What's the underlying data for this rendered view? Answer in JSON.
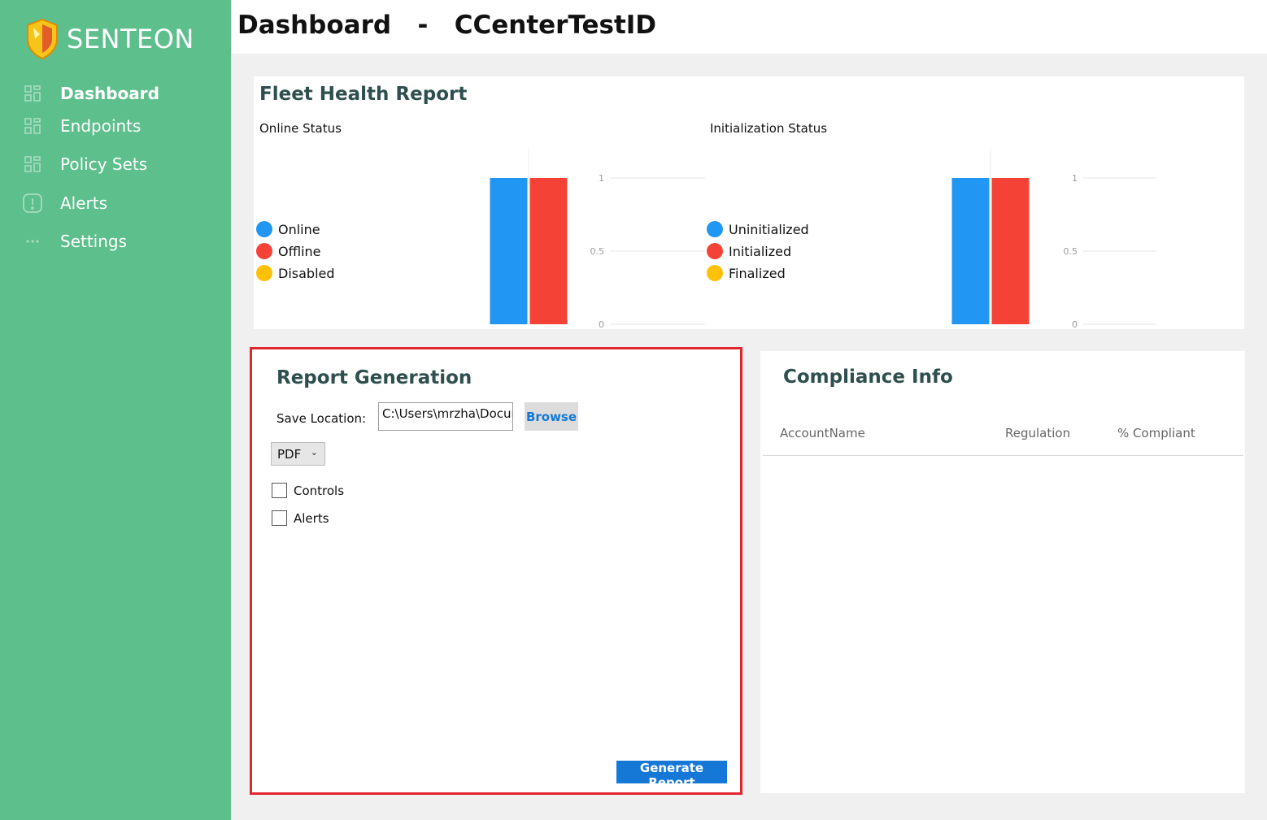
{
  "app": {
    "brand": "SENTEON",
    "header_page": "Dashboard",
    "header_separator": "-",
    "header_context": "CCenterTestID"
  },
  "sidebar": {
    "items": [
      {
        "label": "Dashboard",
        "icon": "grid-icon",
        "active": true
      },
      {
        "label": "Endpoints",
        "icon": "grid-icon",
        "active": false
      },
      {
        "label": "Policy Sets",
        "icon": "grid-icon",
        "active": false
      },
      {
        "label": "Alerts",
        "icon": "alert-icon",
        "active": false
      },
      {
        "label": "Settings",
        "icon": "more-icon",
        "active": false
      }
    ]
  },
  "fleet": {
    "title": "Fleet Health Report"
  },
  "chart_data": [
    {
      "type": "bar",
      "title": "Online Status",
      "categories": [
        ""
      ],
      "series": [
        {
          "name": "Online",
          "values": [
            1
          ],
          "color": "#2196f3"
        },
        {
          "name": "Offline",
          "values": [
            1
          ],
          "color": "#f44336"
        },
        {
          "name": "Disabled",
          "values": [
            0
          ],
          "color": "#ffc107"
        }
      ],
      "yticks": [
        "1",
        "0.5",
        "0"
      ],
      "ylim": [
        0,
        1
      ],
      "legend": "left",
      "grid": true
    },
    {
      "type": "bar",
      "title": "Initialization Status",
      "categories": [
        ""
      ],
      "series": [
        {
          "name": "Uninitialized",
          "values": [
            1
          ],
          "color": "#2196f3"
        },
        {
          "name": "Initialized",
          "values": [
            1
          ],
          "color": "#f44336"
        },
        {
          "name": "Finalized",
          "values": [
            0
          ],
          "color": "#ffc107"
        }
      ],
      "yticks": [
        "1",
        "0.5",
        "0"
      ],
      "ylim": [
        0,
        1
      ],
      "legend": "left",
      "grid": true
    }
  ],
  "report": {
    "title": "Report Generation",
    "save_label": "Save Location:",
    "path_value": "C:\\Users\\mrzha\\Documents",
    "browse_label": "Browse",
    "format_value": "PDF",
    "options": [
      {
        "label": "Controls",
        "checked": false
      },
      {
        "label": "Alerts",
        "checked": false
      }
    ],
    "generate_label": "Generate Report"
  },
  "compliance": {
    "title": "Compliance Info",
    "columns": [
      "AccountName",
      "Regulation",
      "% Compliant"
    ],
    "rows": []
  }
}
